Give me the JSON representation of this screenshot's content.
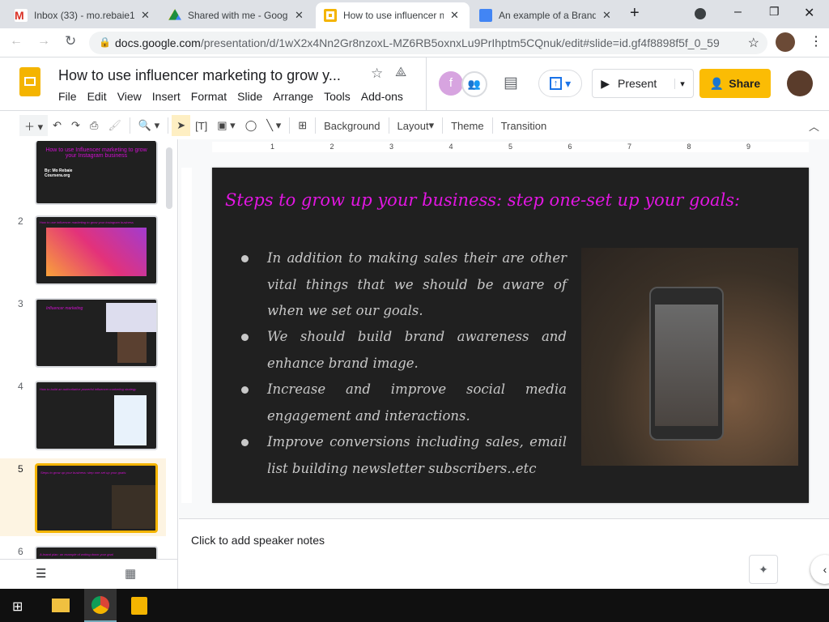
{
  "browser": {
    "tabs": [
      {
        "title": "Inbox (33) - mo.rebaie1",
        "icon": "gmail-icon",
        "color": "#d93025"
      },
      {
        "title": "Shared with me - Goog",
        "icon": "drive-icon",
        "color": "#1e8e3e"
      },
      {
        "title": "How to use influencer m",
        "icon": "slides-icon",
        "color": "#f4b400"
      },
      {
        "title": "An example of a Brand",
        "icon": "docs-icon",
        "color": "#4285f4"
      }
    ],
    "url_host": "docs.google.com",
    "url_path": "/presentation/d/1wX2x4Nn2Gr8nzoxL-MZ6RB5oxnxLu9PrIhptm5CQnuk/edit#slide=id.gf4f8898f5f_0_59"
  },
  "app": {
    "doc_title": "How to use influencer marketing to grow y...",
    "menu": [
      "File",
      "Edit",
      "View",
      "Insert",
      "Format",
      "Slide",
      "Arrange",
      "Tools",
      "Add-ons"
    ],
    "avatar_letter": "f",
    "present": "Present",
    "share": "Share",
    "accent": "#fbbc04"
  },
  "toolbar": {
    "background": "Background",
    "layout": "Layout",
    "theme": "Theme",
    "transition": "Transition"
  },
  "ruler": [
    "1",
    "2",
    "3",
    "4",
    "5",
    "6",
    "7",
    "8",
    "9"
  ],
  "filmstrip": [
    {
      "num": "",
      "title": "How to use Influencer marketing to grow your Instagram business",
      "sub": "By: Mo Rebaie\nCoursera.org"
    },
    {
      "num": "2",
      "title": "How to use influencer marketing to grow your instagram business"
    },
    {
      "num": "3",
      "title": "Influencer marketing"
    },
    {
      "num": "4",
      "title": "How to build an authoritative powerful influencer marketing strategy"
    },
    {
      "num": "5",
      "title": "Steps to grow up your business: step one-set up your goals:"
    },
    {
      "num": "6",
      "title": "A brand plan: an example of writing down your goal"
    }
  ],
  "slide": {
    "title": "Steps to grow up your business: step one-set up your goals:",
    "bullets": [
      "In addition to making sales their are other vital things that we should be aware of when we set our goals.",
      "We should build brand awareness and enhance brand image.",
      "Increase and improve social media engagement and interactions.",
      "Improve conversions including sales, email list building newsletter subscribers..etc"
    ]
  },
  "notes": {
    "placeholder": "Click to add speaker notes"
  }
}
